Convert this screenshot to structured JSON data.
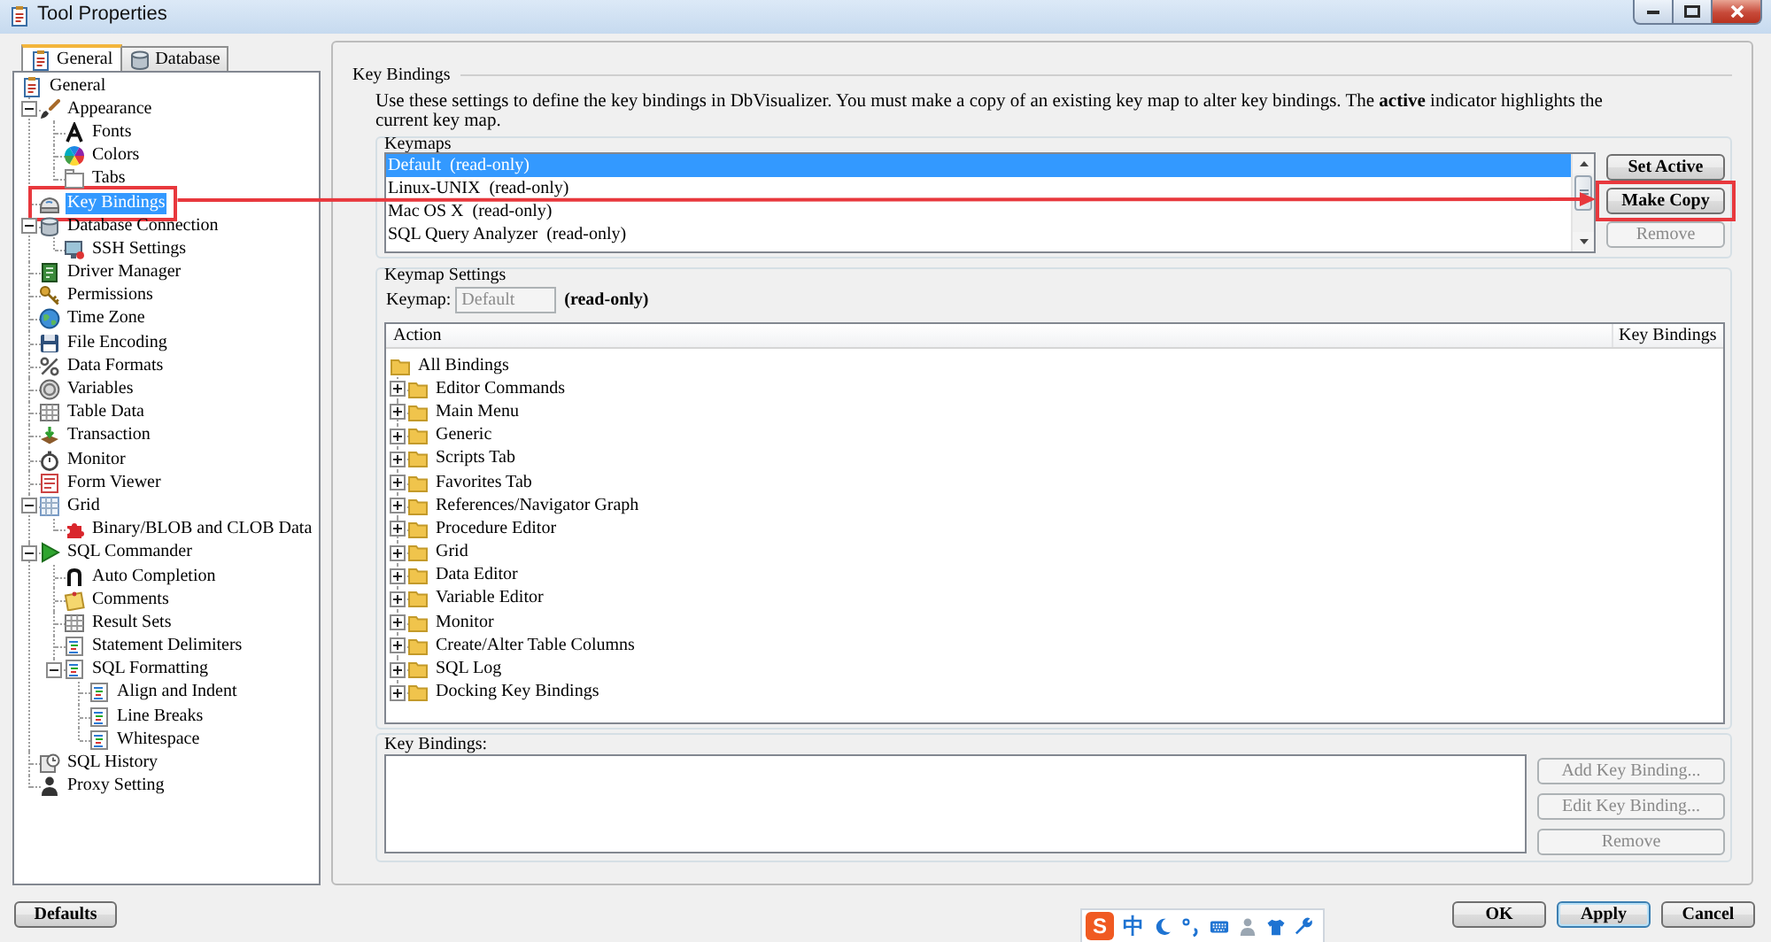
{
  "window": {
    "title": "Tool Properties"
  },
  "sidebar": {
    "tabs": [
      {
        "label": "General",
        "kind": "page",
        "selected": true
      },
      {
        "label": "Database",
        "kind": "database",
        "selected": false
      }
    ],
    "tree": [
      {
        "label": "General",
        "kind": "page",
        "selected": false,
        "highlighted": false,
        "children": [
          {
            "label": "Appearance",
            "kind": "brush",
            "selected": false,
            "highlighted": false,
            "expanded": true,
            "children": [
              {
                "label": "Fonts",
                "kind": "font",
                "selected": false,
                "highlighted": false
              },
              {
                "label": "Colors",
                "kind": "palette",
                "selected": false,
                "highlighted": false
              },
              {
                "label": "Tabs",
                "kind": "tabs",
                "selected": false,
                "highlighted": false
              }
            ]
          },
          {
            "label": "Key Bindings",
            "kind": "mouse",
            "selected": true,
            "highlighted": true
          },
          {
            "label": "Database Connection",
            "kind": "database",
            "selected": false,
            "highlighted": false,
            "expanded": true,
            "children": [
              {
                "label": "SSH Settings",
                "kind": "monitor",
                "selected": false,
                "highlighted": false
              }
            ]
          },
          {
            "label": "Driver Manager",
            "kind": "chip",
            "selected": false,
            "highlighted": false
          },
          {
            "label": "Permissions",
            "kind": "key",
            "selected": false,
            "highlighted": false
          },
          {
            "label": "Time Zone",
            "kind": "globe",
            "selected": false,
            "highlighted": false
          },
          {
            "label": "File Encoding",
            "kind": "disk",
            "selected": false,
            "highlighted": false
          },
          {
            "label": "Data Formats",
            "kind": "percent",
            "selected": false,
            "highlighted": false
          },
          {
            "label": "Variables",
            "kind": "coin",
            "selected": false,
            "highlighted": false
          },
          {
            "label": "Table Data",
            "kind": "table",
            "selected": false,
            "highlighted": false
          },
          {
            "label": "Transaction",
            "kind": "transaction",
            "selected": false,
            "highlighted": false
          },
          {
            "label": "Monitor",
            "kind": "stopwatch",
            "selected": false,
            "highlighted": false
          },
          {
            "label": "Form Viewer",
            "kind": "form",
            "selected": false,
            "highlighted": false
          },
          {
            "label": "Grid",
            "kind": "grid",
            "selected": false,
            "highlighted": false,
            "expanded": true,
            "children": [
              {
                "label": "Binary/BLOB and CLOB Data",
                "kind": "puzzle",
                "selected": false,
                "highlighted": false
              }
            ]
          },
          {
            "label": "SQL Commander",
            "kind": "play",
            "selected": false,
            "highlighted": false,
            "expanded": true,
            "children": [
              {
                "label": "Auto Completion",
                "kind": "arch",
                "selected": false,
                "highlighted": false
              },
              {
                "label": "Comments",
                "kind": "note",
                "selected": false,
                "highlighted": false
              },
              {
                "label": "Result Sets",
                "kind": "table",
                "selected": false,
                "highlighted": false
              },
              {
                "label": "Statement Delimiters",
                "kind": "format",
                "selected": false,
                "highlighted": false
              },
              {
                "label": "SQL Formatting",
                "kind": "format",
                "selected": false,
                "highlighted": false,
                "expanded": true,
                "children": [
                  {
                    "label": "Align and Indent",
                    "kind": "format",
                    "selected": false,
                    "highlighted": false
                  },
                  {
                    "label": "Line Breaks",
                    "kind": "format",
                    "selected": false,
                    "highlighted": false
                  },
                  {
                    "label": "Whitespace",
                    "kind": "format",
                    "selected": false,
                    "highlighted": false
                  }
                ]
              }
            ]
          },
          {
            "label": "SQL History",
            "kind": "history",
            "selected": false,
            "highlighted": false
          },
          {
            "label": "Proxy Setting",
            "kind": "person",
            "selected": false,
            "highlighted": false
          }
        ]
      }
    ]
  },
  "settings": {
    "title": "Key Bindings",
    "description": "Use these settings to define the key bindings in DbVisualizer. You must make a copy of an existing key map to alter key bindings. The **active** indicator highlights the current key map.",
    "keymaps": {
      "title": "Keymaps",
      "items": [
        {
          "label": "Default  (read-only)",
          "selected": true
        },
        {
          "label": "Linux-UNIX  (read-only)",
          "selected": false
        },
        {
          "label": "Mac OS X  (read-only)",
          "selected": false
        },
        {
          "label": "SQL Query Analyzer  (read-only)",
          "selected": false
        }
      ],
      "buttons": [
        {
          "label": "Set Active",
          "disabled": false,
          "highlighted": false
        },
        {
          "label": "Make Copy",
          "disabled": false,
          "highlighted": true
        },
        {
          "label": "Remove",
          "disabled": true,
          "highlighted": false
        }
      ]
    },
    "keymap_settings": {
      "title": "Keymap Settings",
      "keymap_label": "Keymap:",
      "keymap_field": {
        "value": "Default",
        "disabled": true
      },
      "read_only_note": "(read-only)",
      "columns": [
        "Action",
        "Key Bindings"
      ],
      "actions": [
        {
          "label": "All Bindings",
          "children": [
            {
              "label": "Editor Commands",
              "expanded": false
            },
            {
              "label": "Main Menu",
              "expanded": false
            },
            {
              "label": "Generic",
              "expanded": false
            },
            {
              "label": "Scripts Tab",
              "expanded": false
            },
            {
              "label": "Favorites Tab",
              "expanded": false
            },
            {
              "label": "References/Navigator Graph",
              "expanded": false
            },
            {
              "label": "Procedure Editor",
              "expanded": false
            },
            {
              "label": "Grid",
              "expanded": false
            },
            {
              "label": "Data Editor",
              "expanded": false
            },
            {
              "label": "Variable Editor",
              "expanded": false
            },
            {
              "label": "Monitor",
              "expanded": false
            },
            {
              "label": "Create/Alter Table Columns",
              "expanded": false
            },
            {
              "label": "SQL Log",
              "expanded": false
            },
            {
              "label": "Docking Key Bindings",
              "expanded": false
            }
          ]
        }
      ]
    },
    "key_bindings": {
      "label": "Key Bindings:",
      "buttons": [
        {
          "label": "Add Key Binding...",
          "disabled": true
        },
        {
          "label": "Edit Key Binding...",
          "disabled": true
        },
        {
          "label": "Remove",
          "disabled": true
        }
      ]
    }
  },
  "callout_arrow": true,
  "footer": {
    "defaults_button": "Defaults",
    "ime": {
      "logo": "S",
      "mode": "中"
    },
    "buttons": [
      {
        "label": "OK",
        "default": false
      },
      {
        "label": "Apply",
        "default": true
      },
      {
        "label": "Cancel",
        "default": false
      }
    ]
  }
}
